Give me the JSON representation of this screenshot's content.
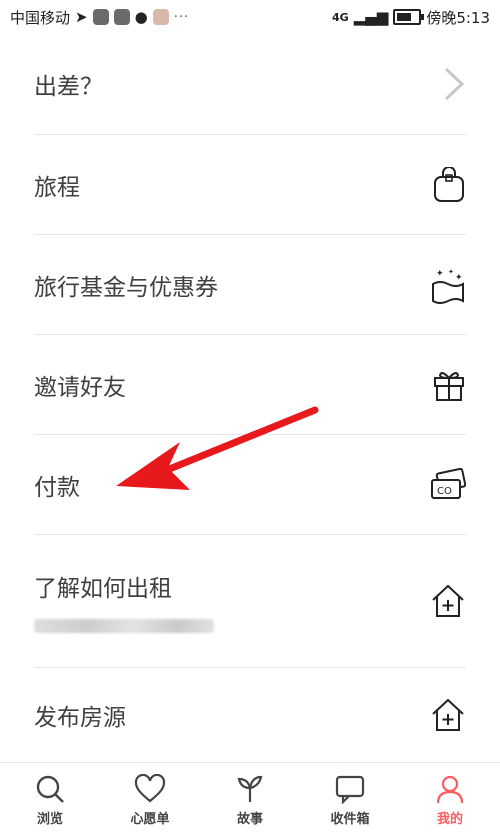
{
  "status_bar": {
    "carrier": "中国移动",
    "network": "4G",
    "time": "傍晚5:13",
    "dots": "···"
  },
  "menu": {
    "items": [
      {
        "label": "出差？",
        "icon": "chevron-right-icon"
      },
      {
        "label": "旅程",
        "icon": "bag-icon"
      },
      {
        "label": "旅行基金与优惠券",
        "icon": "sparkle-fund-icon"
      },
      {
        "label": "邀请好友",
        "icon": "gift-icon"
      },
      {
        "label": "付款",
        "icon": "cash-card-icon"
      },
      {
        "label": "了解如何出租",
        "icon": "house-plus-icon"
      },
      {
        "label": "发布房源",
        "icon": "house-plus-icon"
      }
    ]
  },
  "tab_bar": {
    "tabs": [
      {
        "label": "浏览",
        "icon": "search-icon"
      },
      {
        "label": "心愿单",
        "icon": "heart-icon"
      },
      {
        "label": "故事",
        "icon": "sprout-icon"
      },
      {
        "label": "收件箱",
        "icon": "message-icon"
      },
      {
        "label": "我的",
        "icon": "profile-icon"
      }
    ],
    "active_color": "#ff5a5f"
  },
  "annotation": {
    "arrow_color": "#e8191d"
  }
}
